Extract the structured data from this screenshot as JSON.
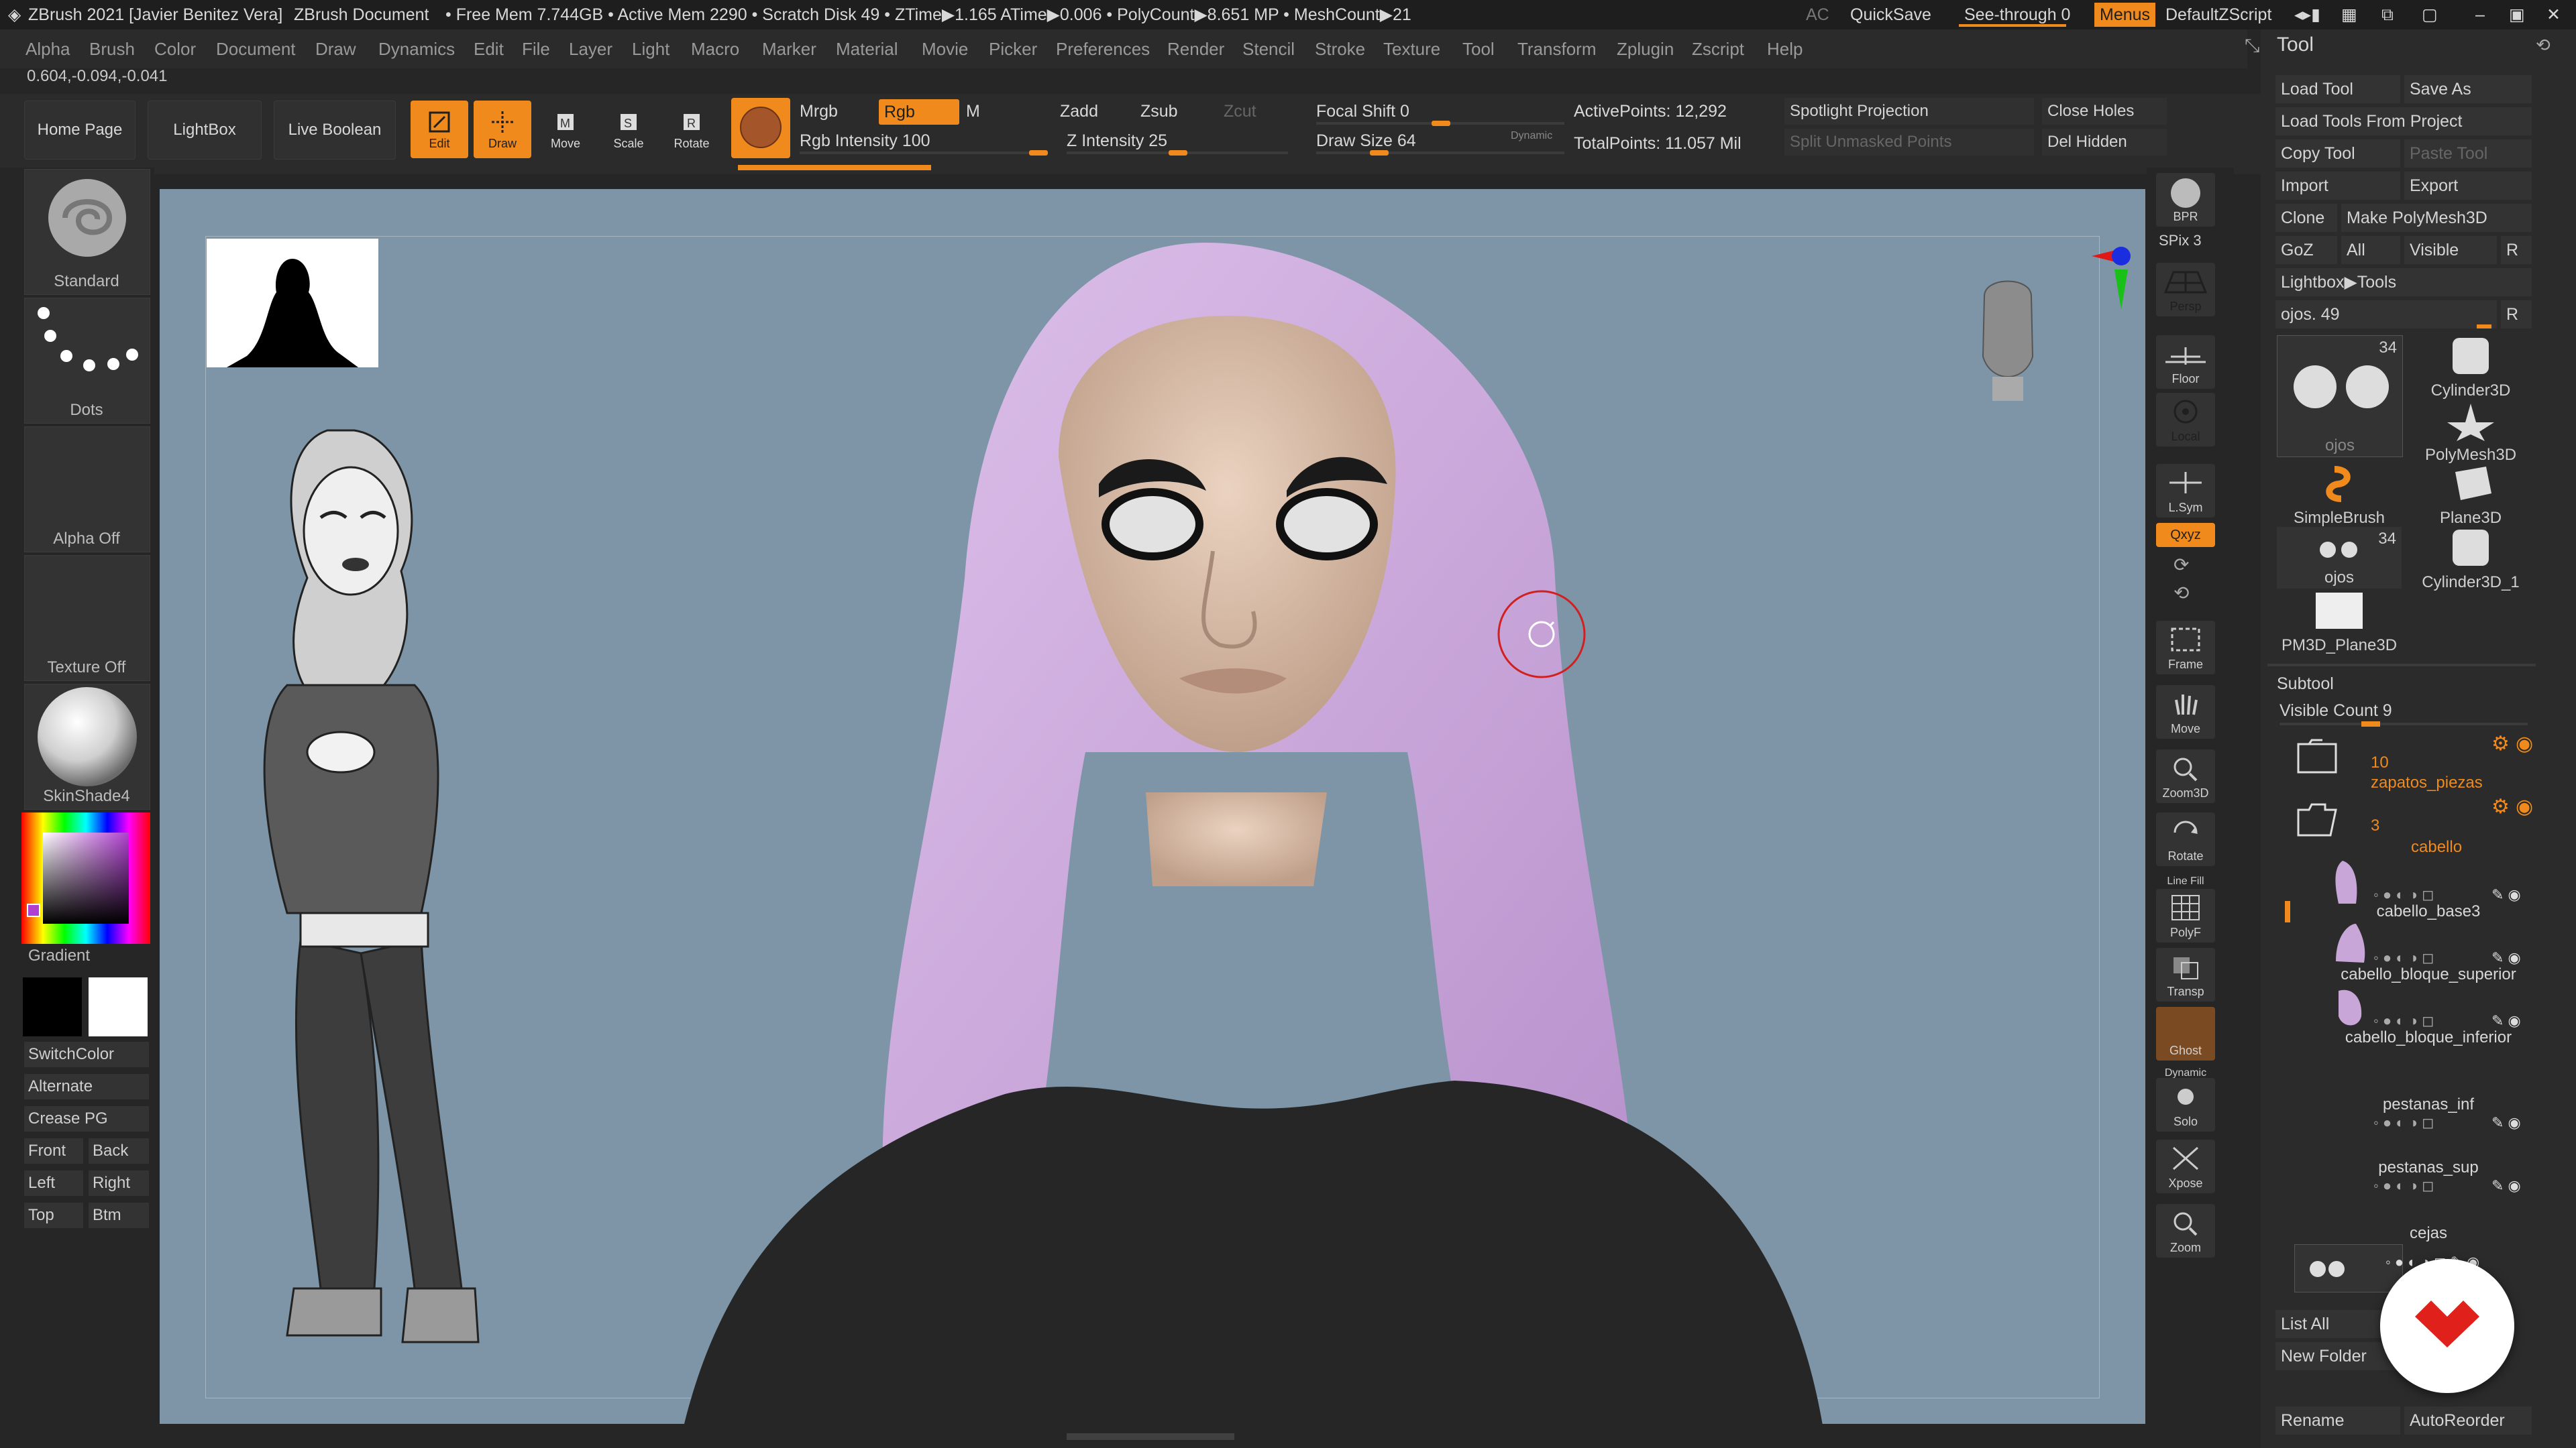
{
  "titlebar": {
    "app": "ZBrush 2021 [Javier Benitez Vera]",
    "doc": "ZBrush Document",
    "stats": "• Free Mem 7.744GB • Active Mem 2290 • Scratch Disk 49 •  ZTime▶1.165 ATime▶0.006 • PolyCount▶8.651 MP  • MeshCount▶21",
    "ac": "AC",
    "quicksave": "QuickSave",
    "seethrough": "See-through  0",
    "menus": "Menus",
    "script": "DefaultZScript"
  },
  "menubar": [
    "Alpha",
    "Brush",
    "Color",
    "Document",
    "Draw",
    "Dynamics",
    "Edit",
    "File",
    "Layer",
    "Light",
    "Macro",
    "Marker",
    "Material",
    "Movie",
    "Picker",
    "Preferences",
    "Render",
    "Stencil",
    "Stroke",
    "Texture",
    "Tool",
    "Transform",
    "Zplugin",
    "Zscript",
    "Help"
  ],
  "coords": "0.604,-0.094,-0.041",
  "shelf": {
    "home": "Home Page",
    "lightbox": "LightBox",
    "liveboolean": "Live Boolean",
    "edit": "Edit",
    "draw": "Draw",
    "move": "Move",
    "scale": "Scale",
    "rotate": "Rotate",
    "mrgb": "Mrgb",
    "rgb": "Rgb",
    "m": "M",
    "rgb_intensity": "Rgb Intensity 100",
    "rgb_intensity_value": 100,
    "zadd": "Zadd",
    "zsub": "Zsub",
    "zcut": "Zcut",
    "z_intensity": "Z Intensity 25",
    "z_intensity_value": 25,
    "focal": "Focal Shift 0",
    "drawsize": "Draw Size 64",
    "dynamic": "Dynamic",
    "activepoints": "ActivePoints: 12,292",
    "totalpoints": "TotalPoints: 11.057 Mil",
    "spotlight": "Spotlight Projection",
    "split": "Split Unmasked Points",
    "closeholes": "Close Holes",
    "delhidden": "Del Hidden"
  },
  "left": {
    "standard": "Standard",
    "dots": "Dots",
    "alpha": "Alpha Off",
    "texture": "Texture Off",
    "material": "SkinShade4",
    "gradient": "Gradient",
    "switchcolor": "SwitchColor",
    "alternate": "Alternate",
    "creasepg": "Crease PG",
    "front": "Front",
    "back": "Back",
    "leftv": "Left",
    "right": "Right",
    "top": "Top",
    "btm": "Btm"
  },
  "rshelf": {
    "bpr": "BPR",
    "spix": "SPix 3",
    "persp": "Persp",
    "floor": "Floor",
    "local": "Local",
    "lsym": "L.Sym",
    "xyz": "Qxyz",
    "frame": "Frame",
    "move": "Move",
    "zoom3d": "Zoom3D",
    "rotate": "Rotate",
    "linefill": "Line Fill",
    "polyf": "PolyF",
    "transp": "Transp",
    "ghost": "Ghost",
    "dynamic": "Dynamic",
    "solo": "Solo",
    "xpose": "Xpose",
    "zoom": "Zoom"
  },
  "tool": {
    "title": "Tool",
    "load": "Load Tool",
    "saveas": "Save As",
    "loadproject": "Load Tools From Project",
    "copy": "Copy Tool",
    "paste": "Paste Tool",
    "import": "Import",
    "export": "Export",
    "clone": "Clone",
    "makepoly": "Make PolyMesh3D",
    "goz": "GoZ",
    "all": "All",
    "visible": "Visible",
    "r": "R",
    "lightboxtools": "Lightbox▶Tools",
    "current": "ojos. 49",
    "thumbs": [
      {
        "name": "ojos",
        "count": "34"
      },
      {
        "name": "Cylinder3D",
        "count": ""
      },
      {
        "name": "PolyMesh3D",
        "count": ""
      },
      {
        "name": "SimpleBrush",
        "count": ""
      },
      {
        "name": "Plane3D",
        "count": ""
      },
      {
        "name": "ojos",
        "count": "34"
      },
      {
        "name": "Cylinder3D_1",
        "count": ""
      },
      {
        "name": "PM3D_Plane3D",
        "count": ""
      }
    ],
    "subtool": "Subtool",
    "visiblecount": "Visible Count 9",
    "subtools": [
      {
        "name": "zapatos_piezas",
        "num": "10",
        "folder": true
      },
      {
        "name": "cabello",
        "num": "3",
        "folder": true
      },
      {
        "name": "cabello_base3",
        "num": "",
        "folder": false
      },
      {
        "name": "cabello_bloque_superior",
        "num": "",
        "folder": false
      },
      {
        "name": "cabello_bloque_inferior",
        "num": "",
        "folder": false
      },
      {
        "name": "pestanas_inf",
        "num": "",
        "folder": false
      },
      {
        "name": "pestanas_sup",
        "num": "",
        "folder": false
      },
      {
        "name": "cejas",
        "num": "",
        "folder": false
      }
    ],
    "listall": "List All",
    "newfolder": "New Folder",
    "rename": "Rename",
    "autoreorder": "AutoReorder"
  }
}
